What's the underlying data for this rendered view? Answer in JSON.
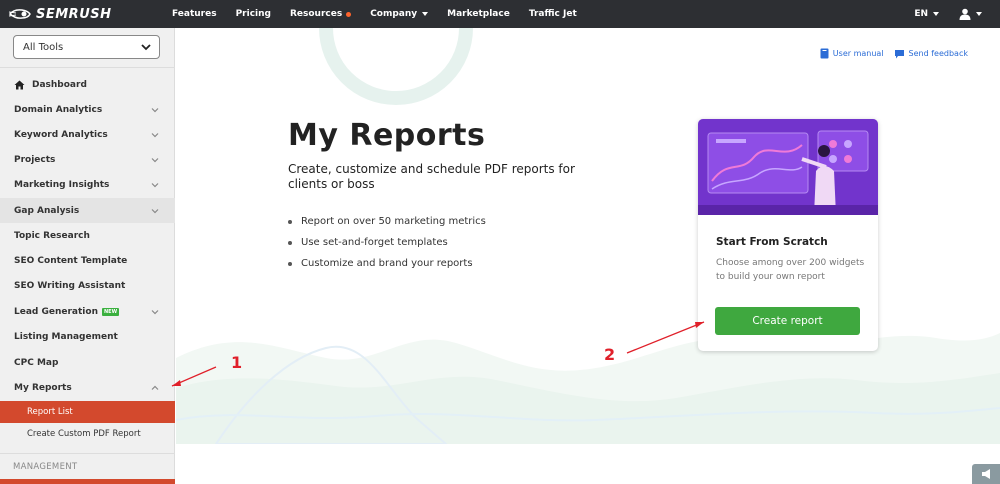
{
  "topbar": {
    "logo_text": "SEMRUSH",
    "nav": [
      {
        "label": "Features"
      },
      {
        "label": "Pricing"
      },
      {
        "label": "Resources"
      },
      {
        "label": "Company"
      },
      {
        "label": "Marketplace"
      },
      {
        "label": "Traffic Jet"
      }
    ],
    "lang": "EN"
  },
  "sidebar": {
    "tools_select": "All Tools",
    "items": [
      {
        "label": "Dashboard"
      },
      {
        "label": "Domain Analytics"
      },
      {
        "label": "Keyword Analytics"
      },
      {
        "label": "Projects"
      },
      {
        "label": "Marketing Insights"
      },
      {
        "label": "Gap Analysis"
      },
      {
        "label": "Topic Research"
      },
      {
        "label": "SEO Content Template"
      },
      {
        "label": "SEO Writing Assistant"
      },
      {
        "label": "Lead Generation"
      },
      {
        "label": "Listing Management"
      },
      {
        "label": "CPC Map"
      },
      {
        "label": "My Reports"
      }
    ],
    "new_badge": "NEW",
    "sub_items": [
      {
        "label": "Report List"
      },
      {
        "label": "Create Custom PDF Report"
      }
    ],
    "section_label": "MANAGEMENT"
  },
  "main": {
    "links": {
      "manual": "User manual",
      "feedback": "Send feedback"
    },
    "title": "My Reports",
    "subtitle": "Create, customize and schedule PDF reports for clients or boss",
    "bullets": [
      "Report on over 50 marketing metrics",
      "Use set-and-forget templates",
      "Customize and brand your reports"
    ],
    "card": {
      "title": "Start From Scratch",
      "description": "Choose among over 200 widgets to build your own report",
      "button": "Create report"
    }
  },
  "annotations": {
    "one": "1",
    "two": "2"
  },
  "colors": {
    "accent": "#d3492d",
    "button": "#3fa83f",
    "link": "#2b6cd6",
    "topbar": "#2d2f33",
    "annotation": "#e0202a"
  }
}
